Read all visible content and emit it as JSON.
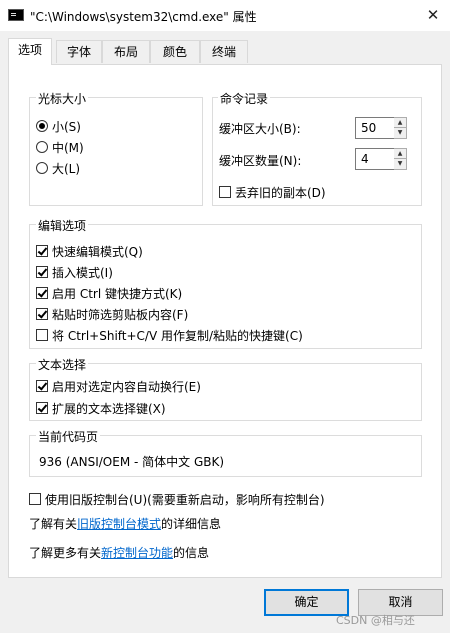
{
  "window": {
    "title": "\"C:\\Windows\\system32\\cmd.exe\" 属性",
    "close_glyph": "✕"
  },
  "tabs": [
    {
      "label": "选项",
      "selected": true
    },
    {
      "label": "字体",
      "selected": false
    },
    {
      "label": "布局",
      "selected": false
    },
    {
      "label": "颜色",
      "selected": false
    },
    {
      "label": "终端",
      "selected": false
    }
  ],
  "cursor_size": {
    "legend": "光标大小",
    "options": [
      {
        "label": "小(S)",
        "checked": true
      },
      {
        "label": "中(M)",
        "checked": false
      },
      {
        "label": "大(L)",
        "checked": false
      }
    ]
  },
  "command_history": {
    "legend": "命令记录",
    "buffer_size": {
      "label": "缓冲区大小(B):",
      "value": "50"
    },
    "buffer_count": {
      "label": "缓冲区数量(N):",
      "value": "4"
    },
    "discard_duplicates": {
      "label": "丢弃旧的副本(D)",
      "checked": false
    }
  },
  "edit_options": {
    "legend": "编辑选项",
    "items": [
      {
        "label": "快速编辑模式(Q)",
        "checked": true
      },
      {
        "label": "插入模式(I)",
        "checked": true
      },
      {
        "label": "启用 Ctrl 键快捷方式(K)",
        "checked": true
      },
      {
        "label": "粘贴时筛选剪贴板内容(F)",
        "checked": true
      },
      {
        "label": "将 Ctrl+Shift+C/V 用作复制/粘贴的快捷键(C)",
        "checked": false
      }
    ]
  },
  "text_selection": {
    "legend": "文本选择",
    "items": [
      {
        "label": "启用对选定内容自动换行(E)",
        "checked": true
      },
      {
        "label": "扩展的文本选择键(X)",
        "checked": true
      }
    ]
  },
  "codepage": {
    "legend": "当前代码页",
    "value": "936   (ANSI/OEM - 简体中文 GBK)"
  },
  "legacy": {
    "label": "使用旧版控制台(U)(需要重新启动，影响所有控制台)",
    "checked": false
  },
  "info1": {
    "prefix": "了解有关",
    "link": "旧版控制台模式",
    "suffix": "的详细信息"
  },
  "info2": {
    "prefix": "了解更多有关",
    "link": "新控制台功能",
    "suffix": "的信息"
  },
  "buttons": {
    "ok": "确定",
    "cancel": "取消"
  },
  "watermark": "CSDN @相与还"
}
